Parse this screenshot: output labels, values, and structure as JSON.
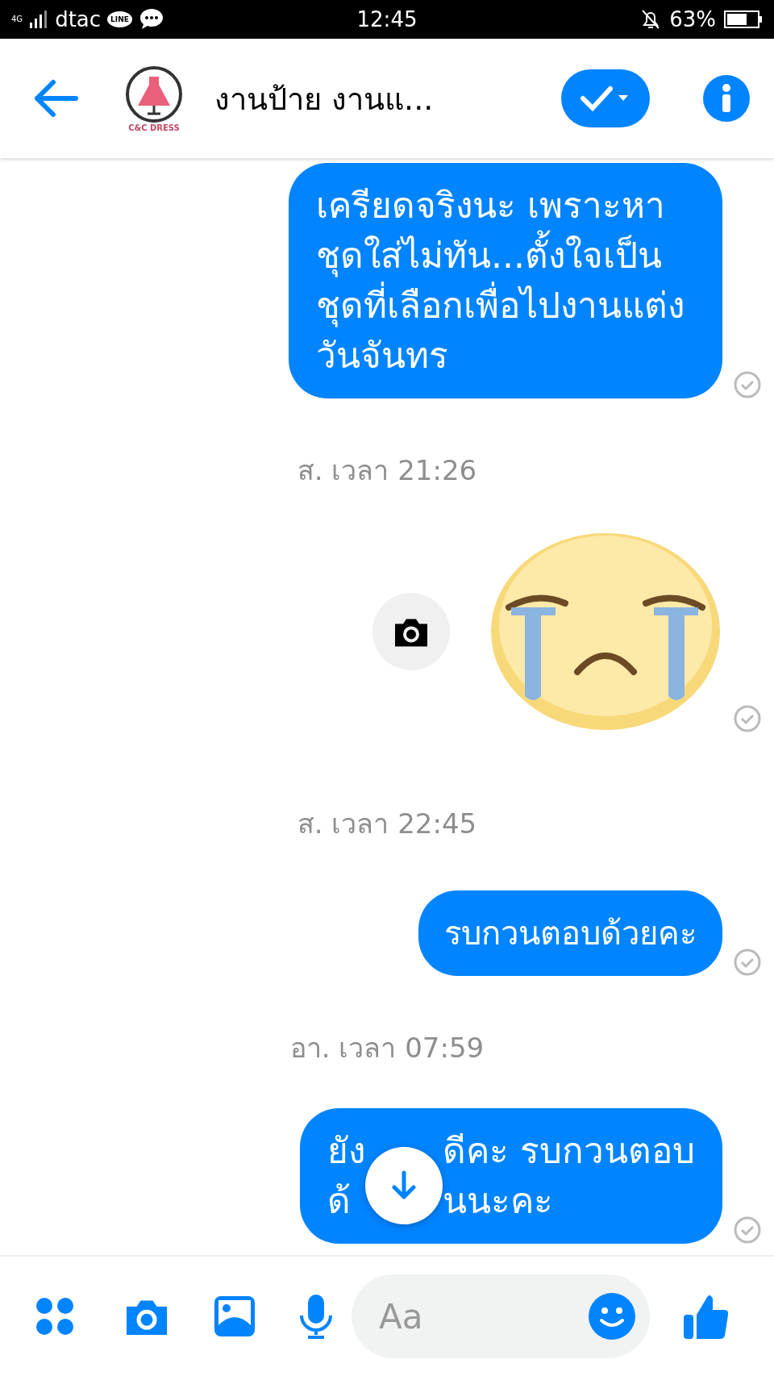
{
  "status_bar": {
    "network": "4G",
    "carrier": "dtac",
    "app_badge": "LINE",
    "time": "12:45",
    "battery": "63%"
  },
  "header": {
    "title": "งานป้าย งานแ...",
    "logo_text": "C&C DRESS"
  },
  "messages": [
    {
      "kind": "text",
      "text": "เครียดจริงนะ เพราะหาชุดใส่ไม่ทัน...ตั้งใจเป็นชุดที่เลือกเพื่อไปงานแต่งวันจันทร",
      "seen": true
    },
    {
      "kind": "timestamp",
      "text": "ส. เวลา 21:26"
    },
    {
      "kind": "sticker",
      "seen": true
    },
    {
      "kind": "timestamp",
      "text": "ส. เวลา 22:45"
    },
    {
      "kind": "text",
      "text": "รบกวนตอบด้วยคะ",
      "seen": true
    },
    {
      "kind": "timestamp",
      "text": "อา. เวลา 07:59"
    },
    {
      "kind": "covered_text",
      "lines": [
        {
          "before": "ยัง",
          "after": "ดีคะ รบกวนตอบ"
        },
        {
          "before": "ด้",
          "after": "นนะคะ"
        }
      ],
      "seen": true,
      "scroll_button": true
    }
  ],
  "composer": {
    "placeholder": "Aa"
  }
}
